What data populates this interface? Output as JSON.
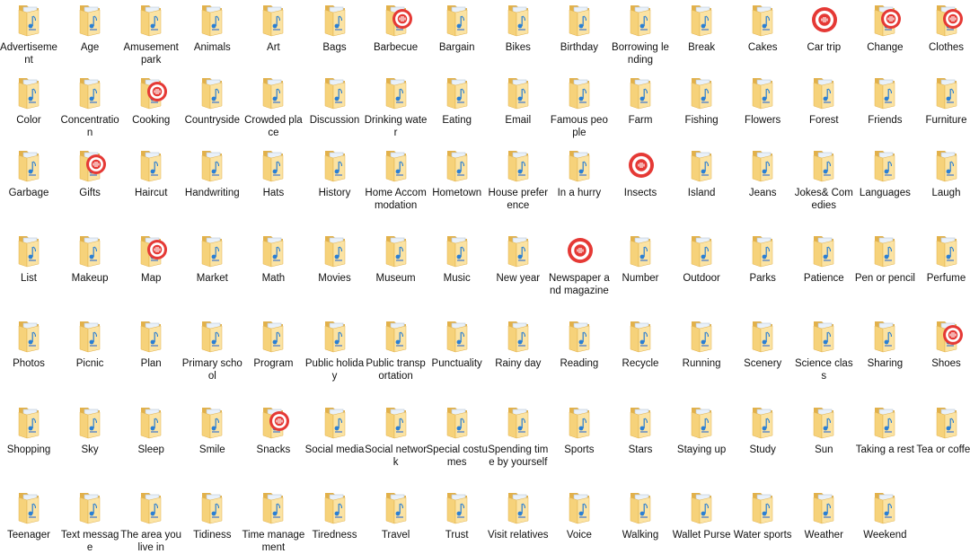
{
  "icon_legend": {
    "folder": "folder-with-audio-file-icon",
    "folder_audio": "folder-with-audio-app-badge-icon",
    "audio": "audio-app-icon"
  },
  "colors": {
    "folder_body": "#f6d27a",
    "folder_edge": "#e2b14a",
    "file_page": "#e9f1fa",
    "music_note": "#2a7fd4",
    "audio_badge": "#e53935"
  },
  "rows": [
    [
      {
        "label": "Advertisement",
        "icon": "folder"
      },
      {
        "label": "Age",
        "icon": "folder"
      },
      {
        "label": "Amusement park",
        "icon": "folder"
      },
      {
        "label": "Animals",
        "icon": "folder"
      },
      {
        "label": "Art",
        "icon": "folder"
      },
      {
        "label": "Bags",
        "icon": "folder"
      },
      {
        "label": "Barbecue",
        "icon": "folder_audio"
      },
      {
        "label": "Bargain",
        "icon": "folder"
      },
      {
        "label": "Bikes",
        "icon": "folder"
      },
      {
        "label": "Birthday",
        "icon": "folder"
      },
      {
        "label": "Borrowing lending",
        "icon": "folder"
      },
      {
        "label": "Break",
        "icon": "folder"
      },
      {
        "label": "Cakes",
        "icon": "folder"
      },
      {
        "label": "Car trip",
        "icon": "audio"
      },
      {
        "label": "Change",
        "icon": "folder_audio"
      },
      {
        "label": "Clothes",
        "icon": "folder_audio"
      }
    ],
    [
      {
        "label": "Color",
        "icon": "folder"
      },
      {
        "label": "Concentration",
        "icon": "folder"
      },
      {
        "label": "Cooking",
        "icon": "folder_audio"
      },
      {
        "label": "Countryside",
        "icon": "folder"
      },
      {
        "label": "Crowded place",
        "icon": "folder"
      },
      {
        "label": "Discussion",
        "icon": "folder"
      },
      {
        "label": "Drinking water",
        "icon": "folder"
      },
      {
        "label": "Eating",
        "icon": "folder"
      },
      {
        "label": "Email",
        "icon": "folder"
      },
      {
        "label": "Famous people",
        "icon": "folder"
      },
      {
        "label": "Farm",
        "icon": "folder"
      },
      {
        "label": "Fishing",
        "icon": "folder"
      },
      {
        "label": "Flowers",
        "icon": "folder"
      },
      {
        "label": "Forest",
        "icon": "folder"
      },
      {
        "label": "Friends",
        "icon": "folder"
      },
      {
        "label": "Furniture",
        "icon": "folder"
      }
    ],
    [
      {
        "label": "Garbage",
        "icon": "folder"
      },
      {
        "label": "Gifts",
        "icon": "folder_audio"
      },
      {
        "label": "Haircut",
        "icon": "folder"
      },
      {
        "label": "Handwriting",
        "icon": "folder"
      },
      {
        "label": "Hats",
        "icon": "folder"
      },
      {
        "label": "History",
        "icon": "folder"
      },
      {
        "label": "Home Accommodation",
        "icon": "folder"
      },
      {
        "label": "Hometown",
        "icon": "folder"
      },
      {
        "label": "House preference",
        "icon": "folder"
      },
      {
        "label": "In a hurry",
        "icon": "folder"
      },
      {
        "label": "Insects",
        "icon": "audio"
      },
      {
        "label": "Island",
        "icon": "folder"
      },
      {
        "label": "Jeans",
        "icon": "folder"
      },
      {
        "label": "Jokes& Comedies",
        "icon": "folder"
      },
      {
        "label": "Languages",
        "icon": "folder"
      },
      {
        "label": "Laugh",
        "icon": "folder"
      }
    ],
    [
      {
        "label": "List",
        "icon": "folder"
      },
      {
        "label": "Makeup",
        "icon": "folder"
      },
      {
        "label": "Map",
        "icon": "folder_audio"
      },
      {
        "label": "Market",
        "icon": "folder"
      },
      {
        "label": "Math",
        "icon": "folder"
      },
      {
        "label": "Movies",
        "icon": "folder"
      },
      {
        "label": "Museum",
        "icon": "folder"
      },
      {
        "label": "Music",
        "icon": "folder"
      },
      {
        "label": "New year",
        "icon": "folder"
      },
      {
        "label": "Newspaper and magazine",
        "icon": "audio"
      },
      {
        "label": "Number",
        "icon": "folder"
      },
      {
        "label": "Outdoor",
        "icon": "folder"
      },
      {
        "label": "Parks",
        "icon": "folder"
      },
      {
        "label": "Patience",
        "icon": "folder"
      },
      {
        "label": "Pen or pencil",
        "icon": "folder"
      },
      {
        "label": "Perfume",
        "icon": "folder"
      }
    ],
    [
      {
        "label": "Photos",
        "icon": "folder"
      },
      {
        "label": "Picnic",
        "icon": "folder"
      },
      {
        "label": "Plan",
        "icon": "folder"
      },
      {
        "label": "Primary school",
        "icon": "folder"
      },
      {
        "label": "Program",
        "icon": "folder"
      },
      {
        "label": "Public holiday",
        "icon": "folder"
      },
      {
        "label": "Public transportation",
        "icon": "folder"
      },
      {
        "label": "Punctuality",
        "icon": "folder"
      },
      {
        "label": "Rainy day",
        "icon": "folder"
      },
      {
        "label": "Reading",
        "icon": "folder"
      },
      {
        "label": "Recycle",
        "icon": "folder"
      },
      {
        "label": "Running",
        "icon": "folder"
      },
      {
        "label": "Scenery",
        "icon": "folder"
      },
      {
        "label": "Science class",
        "icon": "folder"
      },
      {
        "label": "Sharing",
        "icon": "folder"
      },
      {
        "label": "Shoes",
        "icon": "folder_audio"
      }
    ],
    [
      {
        "label": "Shopping",
        "icon": "folder"
      },
      {
        "label": "Sky",
        "icon": "folder"
      },
      {
        "label": "Sleep",
        "icon": "folder"
      },
      {
        "label": "Smile",
        "icon": "folder"
      },
      {
        "label": "Snacks",
        "icon": "folder_audio"
      },
      {
        "label": "Social media",
        "icon": "folder"
      },
      {
        "label": "Social network",
        "icon": "folder"
      },
      {
        "label": "Special costumes",
        "icon": "folder"
      },
      {
        "label": "Spending time by yourself",
        "icon": "folder"
      },
      {
        "label": "Sports",
        "icon": "folder"
      },
      {
        "label": "Stars",
        "icon": "folder"
      },
      {
        "label": "Staying up",
        "icon": "folder"
      },
      {
        "label": "Study",
        "icon": "folder"
      },
      {
        "label": "Sun",
        "icon": "folder"
      },
      {
        "label": "Taking a rest",
        "icon": "folder"
      },
      {
        "label": "Tea or coffee",
        "icon": "folder"
      }
    ],
    [
      {
        "label": "Teenager",
        "icon": "folder"
      },
      {
        "label": "Text message",
        "icon": "folder"
      },
      {
        "label": "The area you live in",
        "icon": "folder"
      },
      {
        "label": "Tidiness",
        "icon": "folder"
      },
      {
        "label": "Time management",
        "icon": "folder"
      },
      {
        "label": "Tiredness",
        "icon": "folder"
      },
      {
        "label": "Travel",
        "icon": "folder"
      },
      {
        "label": "Trust",
        "icon": "folder"
      },
      {
        "label": "Visit relatives",
        "icon": "folder"
      },
      {
        "label": "Voice",
        "icon": "folder"
      },
      {
        "label": "Walking",
        "icon": "folder"
      },
      {
        "label": "Wallet Purse",
        "icon": "folder"
      },
      {
        "label": "Water sports",
        "icon": "folder"
      },
      {
        "label": "Weather",
        "icon": "folder"
      },
      {
        "label": "Weekend",
        "icon": "folder"
      }
    ]
  ]
}
